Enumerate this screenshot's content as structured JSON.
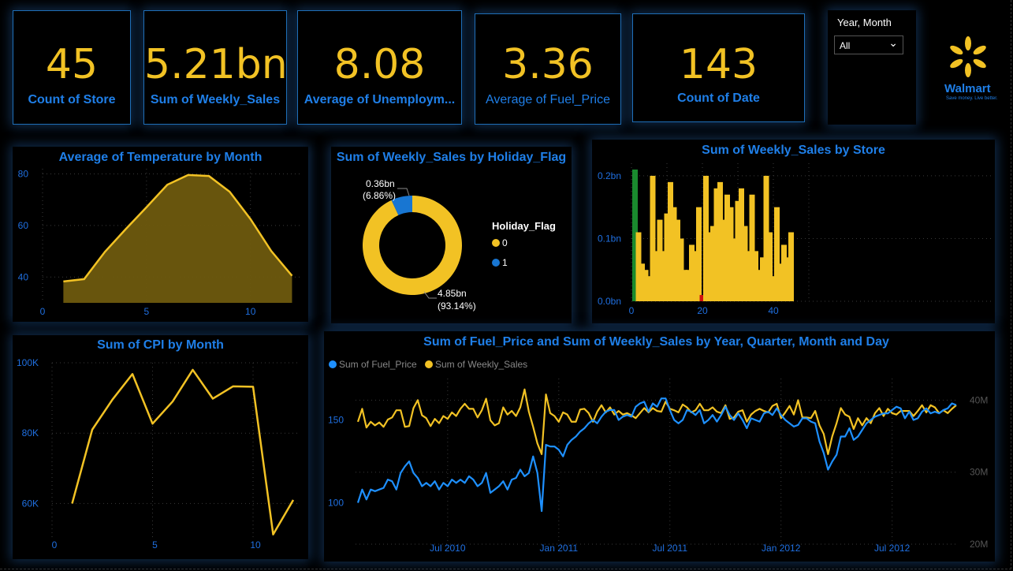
{
  "kpis": [
    {
      "value": "45",
      "label": "Count of Store"
    },
    {
      "value": "5.21bn",
      "label": "Sum of Weekly_Sales"
    },
    {
      "value": "8.08",
      "label": "Average of Unemploym..."
    },
    {
      "value": "3.36",
      "label": "Average of Fuel_Price"
    },
    {
      "value": "143",
      "label": "Count of Date"
    }
  ],
  "slicer": {
    "title": "Year, Month",
    "value": "All"
  },
  "logo": {
    "name": "Walmart",
    "tagline": "Save money. Live better."
  },
  "colors": {
    "accent": "#f2c224",
    "blue": "#1f7fe8",
    "fuel": "#1e90ff",
    "green": "#1a8a2e",
    "red": "#d01010"
  },
  "chart_data": [
    {
      "type": "area",
      "title": "Average of Temperature by Month",
      "x": [
        1,
        2,
        3,
        4,
        5,
        6,
        7,
        8,
        9,
        10,
        11,
        12
      ],
      "values": [
        38.3,
        39.2,
        49.8,
        58.6,
        67.1,
        75.8,
        79.6,
        79.2,
        73.1,
        62.5,
        50.1,
        40.5
      ],
      "xticks": [
        "0",
        "5",
        "10"
      ],
      "yticks": [
        "40",
        "60",
        "80"
      ],
      "xlim": [
        0,
        12.4
      ],
      "ylim": [
        30,
        82
      ]
    },
    {
      "type": "pie",
      "title": "Sum of Weekly_Sales by Holiday_Flag",
      "legend_title": "Holiday_Flag",
      "slices": [
        {
          "name": "0",
          "value": 4.85,
          "label": "4.85bn",
          "pct": "(93.14%)"
        },
        {
          "name": "1",
          "value": 0.36,
          "label": "0.36bn",
          "pct": "(6.86%)"
        }
      ]
    },
    {
      "type": "bar",
      "title": "Sum of Weekly_Sales by Store",
      "x": [
        1,
        2,
        3,
        4,
        5,
        6,
        7,
        8,
        9,
        10,
        11,
        12,
        13,
        14,
        15,
        16,
        17,
        18,
        19,
        20,
        21,
        22,
        23,
        24,
        25,
        26,
        27,
        28,
        29,
        30,
        31,
        32,
        33,
        34,
        35,
        36,
        37,
        38,
        39,
        40,
        41,
        42,
        43,
        44,
        45
      ],
      "values": [
        0.21,
        0.11,
        0.06,
        0.05,
        0.04,
        0.2,
        0.08,
        0.13,
        0.08,
        0.14,
        0.19,
        0.15,
        0.13,
        0.1,
        0.05,
        0.05,
        0.09,
        0.08,
        0.15,
        0.01,
        0.2,
        0.11,
        0.12,
        0.18,
        0.19,
        0.13,
        0.17,
        0.15,
        0.1,
        0.16,
        0.18,
        0.12,
        0.08,
        0.17,
        0.08,
        0.05,
        0.07,
        0.2,
        0.11,
        0.04,
        0.15,
        0.06,
        0.09,
        0.07,
        0.11
      ],
      "highlight": {
        "1": "#1a8a2e",
        "20": "#d01010"
      },
      "xticks": [
        "0",
        "20",
        "40"
      ],
      "yticks": [
        "0.0bn",
        "0.1bn",
        "0.2bn"
      ],
      "ylim": [
        0,
        0.22
      ]
    },
    {
      "type": "line",
      "title": "Sum of CPI by Month",
      "x": [
        1,
        2,
        3,
        4,
        5,
        6,
        7,
        8,
        9,
        10,
        11,
        12
      ],
      "values": [
        60000,
        81000,
        89500,
        96800,
        82700,
        89000,
        98000,
        89800,
        93300,
        93200,
        51200,
        61000
      ],
      "xticks": [
        "0",
        "5",
        "10"
      ],
      "yticks": [
        "60K",
        "80K",
        "100K"
      ],
      "ylim": [
        50000,
        100000
      ]
    },
    {
      "type": "line",
      "title": "Sum of Fuel_Price and Sum of Weekly_Sales by Year, Quarter, Month and Day",
      "series": [
        {
          "name": "Sum of Fuel_Price",
          "axis": "left",
          "values": [
            100,
            108,
            102,
            108,
            107,
            108,
            109,
            114,
            113,
            108,
            118,
            122,
            125,
            118,
            115,
            110,
            112,
            110,
            113,
            108,
            112,
            110,
            114,
            112,
            114,
            112,
            116,
            114,
            110,
            112,
            118,
            106,
            108,
            110,
            113,
            108,
            114,
            115,
            120,
            116,
            118,
            128,
            118,
            95,
            135,
            134,
            134,
            132,
            128,
            135,
            138,
            140,
            143,
            145,
            148,
            150,
            148,
            152,
            155,
            156,
            156,
            150,
            152,
            153,
            152,
            158,
            160,
            161,
            155,
            160,
            158,
            163,
            163,
            156,
            150,
            148,
            150,
            156,
            155,
            153,
            156,
            148,
            150,
            153,
            149,
            153,
            158,
            153,
            150,
            154,
            150,
            145,
            151,
            150,
            149,
            154,
            155,
            153,
            157,
            153,
            150,
            148,
            146,
            147,
            151,
            151,
            149,
            148,
            137,
            130,
            120,
            125,
            129,
            140,
            140,
            145,
            138,
            140,
            144,
            148,
            150,
            152,
            153,
            154,
            154,
            156,
            158,
            157,
            151,
            155,
            150,
            151,
            155,
            157,
            154,
            155,
            154,
            156,
            157,
            160,
            159
          ]
        },
        {
          "name": "Sum of Weekly_Sales",
          "axis": "right",
          "values": [
            37.0,
            38.8,
            36.2,
            37.0,
            36.5,
            36.9,
            36.3,
            37.3,
            37.6,
            38.6,
            38.6,
            36.3,
            36.4,
            38.9,
            40.0,
            37.9,
            37.5,
            36.4,
            37.4,
            36.8,
            37.8,
            37.4,
            38.3,
            37.8,
            38.8,
            39.5,
            38.8,
            38.8,
            37.6,
            38.6,
            40.2,
            37.2,
            36.5,
            36.8,
            39.0,
            38.0,
            38.5,
            37.8,
            39.0,
            41.5,
            38.4,
            36.3,
            34.0,
            32.5,
            40.8,
            38.2,
            37.8,
            37.0,
            38.3,
            38.0,
            37.0,
            37.0,
            38.7,
            38.8,
            38.2,
            37.0,
            38.4,
            39.3,
            38.3,
            39.0,
            38.0,
            38.5,
            38.0,
            38.2,
            37.9,
            37.5,
            38.2,
            38.9,
            38.3,
            38.9,
            38.5,
            38.4,
            39.8,
            38.8,
            38.6,
            38.3,
            39.4,
            39.0,
            38.3,
            38.6,
            39.5,
            38.6,
            38.6,
            39.0,
            38.4,
            38.2,
            39.3,
            37.4,
            37.6,
            38.4,
            38.6,
            37.0,
            38.0,
            38.5,
            38.8,
            38.5,
            38.3,
            39.2,
            39.5,
            37.5,
            38.3,
            39.2,
            38.0,
            40.0,
            37.6,
            37.6,
            37.5,
            38.5,
            36.5,
            35.3,
            32.5,
            35.0,
            36.8,
            38.9,
            38.0,
            37.7,
            36.0,
            37.5,
            36.5,
            37.5,
            36.8,
            38.2,
            38.9,
            37.8,
            38.8,
            38.2,
            38.0,
            38.5,
            38.5,
            38.5,
            37.8,
            38.5,
            39.3,
            38.3,
            39.3,
            39.0,
            38.2,
            38.6,
            38.2,
            38.8,
            39.3
          ]
        }
      ],
      "left_yticks": [
        "100",
        "150"
      ],
      "right_yticks": [
        "20M",
        "30M",
        "40M"
      ],
      "xticks": [
        "Jul 2010",
        "Jan 2011",
        "Jul 2011",
        "Jan 2012",
        "Jul 2012"
      ],
      "left_ylim": [
        75,
        175
      ],
      "right_ylim": [
        20,
        43
      ]
    }
  ]
}
